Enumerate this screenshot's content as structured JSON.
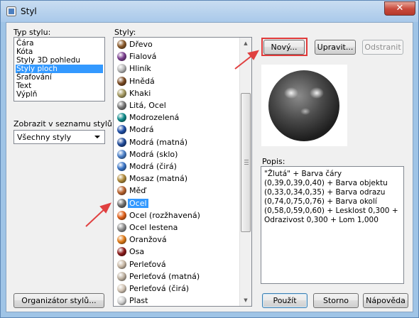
{
  "window": {
    "title": "Styl",
    "close_label": "✕"
  },
  "type_section": {
    "label": "Typ stylu:",
    "items": [
      "Čára",
      "Kóta",
      "Styly 3D pohledu",
      "Styly ploch",
      "Šrafování",
      "Text",
      "Výplň"
    ],
    "selected": "Styly ploch"
  },
  "filter": {
    "label": "Zobrazit v seznamu stylů:",
    "value": "Všechny styly"
  },
  "styles_section": {
    "label": "Styly:",
    "items": [
      {
        "name": "Dřevo",
        "color": "#8a5a2b"
      },
      {
        "name": "Fialová",
        "color": "#7b3f8f"
      },
      {
        "name": "Hliník",
        "color": "#b8b8b8"
      },
      {
        "name": "Hnědá",
        "color": "#7a4a22"
      },
      {
        "name": "Khaki",
        "color": "#a59a62"
      },
      {
        "name": "Litá, Ocel",
        "color": "#777777"
      },
      {
        "name": "Modrozelená",
        "color": "#0f8a8a"
      },
      {
        "name": "Modrá",
        "color": "#1f4fa8"
      },
      {
        "name": "Modrá (matná)",
        "color": "#1f4a99"
      },
      {
        "name": "Modrá (sklo)",
        "color": "#4a7fc8"
      },
      {
        "name": "Modrá (čirá)",
        "color": "#3a74c6"
      },
      {
        "name": "Mosaz (matná)",
        "color": "#b08a3a"
      },
      {
        "name": "Měď",
        "color": "#b8622e"
      },
      {
        "name": "Ocel",
        "color": "#6e6e6e"
      },
      {
        "name": "Ocel (rozžhavená)",
        "color": "#e0601a"
      },
      {
        "name": "Ocel lestena",
        "color": "#8c8c8c"
      },
      {
        "name": "Oranžová",
        "color": "#e07b18"
      },
      {
        "name": "Osa",
        "color": "#8a1a1a"
      },
      {
        "name": "Perleťová",
        "color": "#c9b9a6"
      },
      {
        "name": "Perleťová (matná)",
        "color": "#bfb2a2"
      },
      {
        "name": "Perleťová (čirá)",
        "color": "#d2c4b4"
      },
      {
        "name": "Plast",
        "color": "#cfcfcf"
      }
    ],
    "selected": "Ocel"
  },
  "buttons": {
    "new": "Nový...",
    "edit": "Upravit...",
    "remove": "Odstranit",
    "organizer": "Organizátor stylů...",
    "apply": "Použít",
    "cancel": "Storno",
    "help": "Nápověda"
  },
  "description": {
    "label": "Popis:",
    "text": "\"Žlutá\" + Barva čáry (0,39,0,39,0,40) + Barva objektu (0,33,0,34,0,35) + Barva odrazu (0,74,0,75,0,76) + Barva okolí (0,58,0,59,0,60) + Lesklost 0,300 + Odrazivost 0,300 + Lom 1,000"
  },
  "colors": {
    "highlight": "#e03a3a",
    "selection": "#3399ff"
  }
}
